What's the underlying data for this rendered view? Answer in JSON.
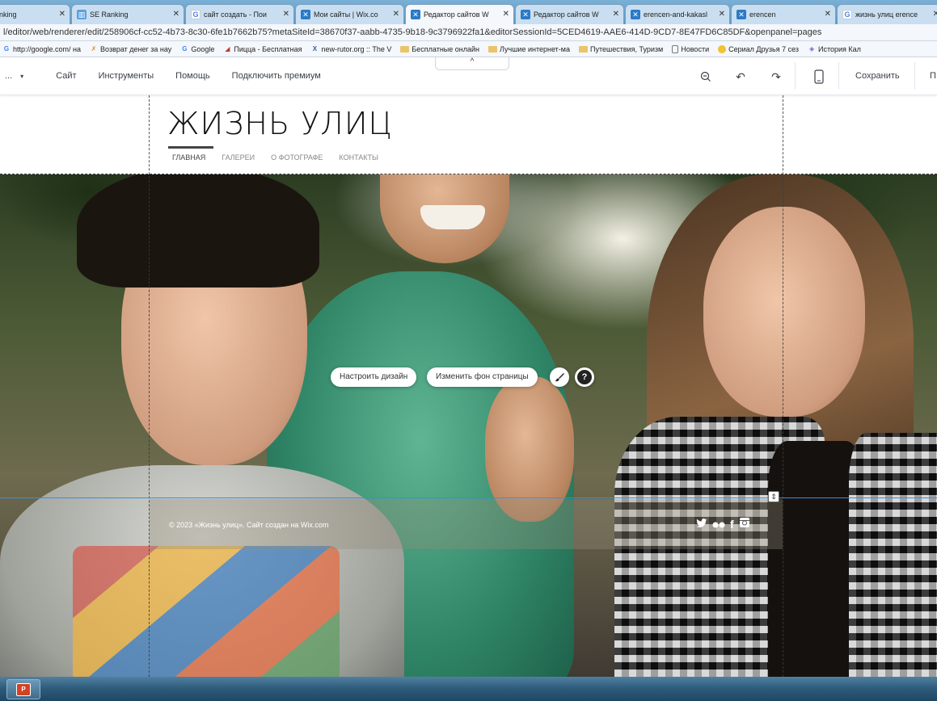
{
  "browser": {
    "tabs": [
      {
        "title": "nking",
        "icon": "blank",
        "active": false
      },
      {
        "title": "SE Ranking",
        "icon": "se-ranking",
        "active": false
      },
      {
        "title": "сайт создать - Пои",
        "icon": "google",
        "active": false
      },
      {
        "title": "Мои сайты | Wix.co",
        "icon": "wix",
        "active": false
      },
      {
        "title": "Редактор сайтов W",
        "icon": "wix",
        "active": true
      },
      {
        "title": "Редактор сайтов W",
        "icon": "wix",
        "active": false
      },
      {
        "title": "erencen-and-kakasl",
        "icon": "wix",
        "active": false
      },
      {
        "title": "erencen",
        "icon": "wix",
        "active": false
      },
      {
        "title": "жизнь улиц erence",
        "icon": "google",
        "active": false
      }
    ],
    "url": "l/editor/web/renderer/edit/258906cf-cc52-4b73-8c30-6fe1b7662b75?metaSiteId=38670f37-aabb-4735-9b18-9c3796922fa1&editorSessionId=5CED4619-AAE6-414D-9CD7-8E47FD6C85DF&openpanel=pages",
    "bookmarks": [
      {
        "label": "http://google.com/ на",
        "icon": "google"
      },
      {
        "label": "Возврат денег за нау",
        "icon": "ribbon"
      },
      {
        "label": "Google",
        "icon": "google"
      },
      {
        "label": "Пицца - Бесплатная",
        "icon": "pizza"
      },
      {
        "label": "new-rutor.org :: The V",
        "icon": "rutor"
      },
      {
        "label": "Бесплатные онлайн",
        "icon": "folder"
      },
      {
        "label": "Лучшие интернет-ма",
        "icon": "folder"
      },
      {
        "label": "Путешествия, Туризм",
        "icon": "folder"
      },
      {
        "label": "Новости",
        "icon": "page"
      },
      {
        "label": "Сериал Друзья 7 сез",
        "icon": "smiley"
      },
      {
        "label": "История Кал",
        "icon": "diamond"
      }
    ]
  },
  "wix_toolbar": {
    "page_selector": "...",
    "menu": [
      "Сайт",
      "Инструменты",
      "Помощь",
      "Подключить премиум"
    ],
    "collapse_glyph": "^",
    "save_label": "Сохранить",
    "preview_label_cut": "П"
  },
  "site": {
    "title": "ЖИЗНЬ УЛИЦ",
    "nav": [
      "ГЛАВНАЯ",
      "ГАЛЕРЕИ",
      "О ФОТОГРАФЕ",
      "КОНТАКТЫ"
    ],
    "copyright": "© 2023 «Жизнь улиц». Сайт создан на Wix.com",
    "social": [
      "twitter",
      "flickr",
      "facebook",
      "instagram"
    ]
  },
  "canvas_actions": {
    "customize_design": "Настроить дизайн",
    "change_background": "Изменить фон страницы"
  },
  "colors": {
    "blue_guide": "#3b8ee0",
    "taskbar": "#2e5a7a"
  }
}
